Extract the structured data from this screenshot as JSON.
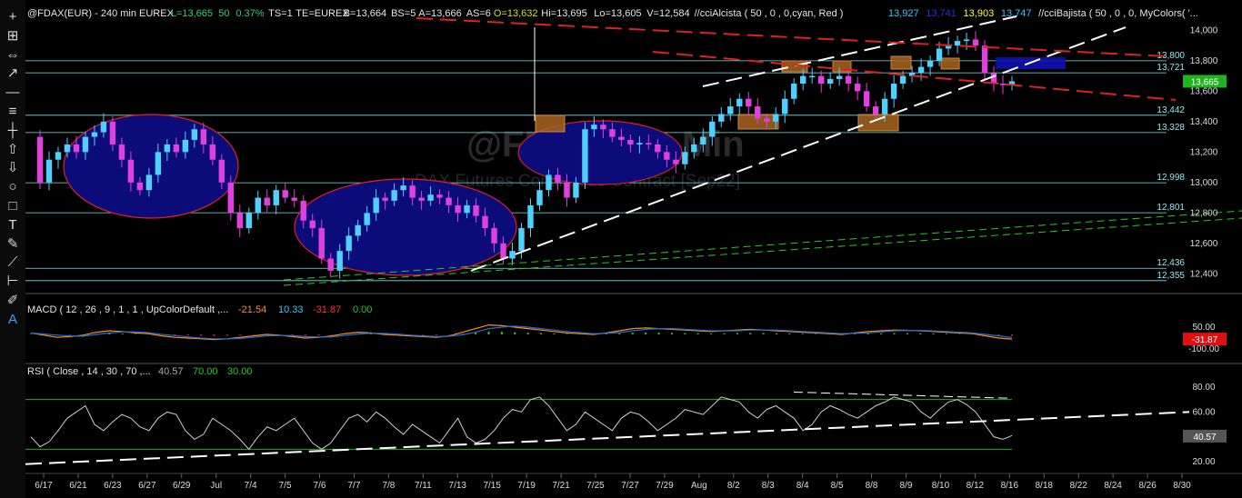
{
  "header": {
    "segments": [
      {
        "text": "@FDAX(EUR) - 240 min  EUREX",
        "color": "#e6e6e6"
      },
      {
        "text": "L=13,665",
        "color": "#27d27d"
      },
      {
        "text": "50",
        "color": "#27d27d"
      },
      {
        "text": "0.37%",
        "color": "#27d27d"
      },
      {
        "text": "TS=1",
        "color": "#e6e6e6"
      },
      {
        "text": "TE=EUREX",
        "color": "#e6e6e6"
      },
      {
        "text": "B=13,664",
        "color": "#e6e6e6"
      },
      {
        "text": "BS=5",
        "color": "#e6e6e6"
      },
      {
        "text": "A=13,666",
        "color": "#e6e6e6"
      },
      {
        "text": "AS=6",
        "color": "#e6e6e6"
      },
      {
        "text": "O=13,632",
        "color": "#c8e61e"
      },
      {
        "text": "Hi=13,695",
        "color": "#e6e6e6"
      },
      {
        "text": "Lo=13,605",
        "color": "#e6e6e6"
      },
      {
        "text": "V=12,584",
        "color": "#e6e6e6"
      },
      {
        "text": "//cciAlcista ( 50 , 0 , 0,cyan, Red )",
        "color": "#e6e6e6"
      },
      {
        "text": "13,927",
        "color": "#32c8ff"
      },
      {
        "text": "13,741",
        "color": "#2830d8"
      },
      {
        "text": "13,903",
        "color": "#ffff32"
      },
      {
        "text": "13,747",
        "color": "#32c8ff"
      },
      {
        "text": "//cciBajista ( 50 , 0 , 0, MyColors( '...",
        "color": "#e6e6e6"
      }
    ]
  },
  "watermark": {
    "symbol": "@FDAX 240 Min",
    "description": "DAX  Futures Continuous Contract [Sep22]"
  },
  "toolbar": {
    "icons": [
      {
        "name": "crosshair-icon",
        "glyph": "+"
      },
      {
        "name": "multi-crosshair-icon",
        "glyph": "⊞"
      },
      {
        "name": "horizontal-measure-icon",
        "glyph": "⇔"
      },
      {
        "name": "trendline-icon",
        "glyph": "↗"
      },
      {
        "name": "horizontal-line-icon",
        "glyph": "—"
      },
      {
        "name": "lines-group-icon",
        "glyph": "≡"
      },
      {
        "name": "vertical-line-icon",
        "glyph": "┼"
      },
      {
        "name": "arrow-up-icon",
        "glyph": "⇧"
      },
      {
        "name": "arrow-down-icon",
        "glyph": "⇩"
      },
      {
        "name": "ellipse-icon",
        "glyph": "○"
      },
      {
        "name": "rectangle-icon",
        "glyph": "□"
      },
      {
        "name": "text-tool-icon",
        "glyph": "T"
      },
      {
        "name": "pencil-icon",
        "glyph": "✎"
      },
      {
        "name": "ruler-icon",
        "glyph": "⟋"
      },
      {
        "name": "fibonacci-icon",
        "glyph": "⊢"
      },
      {
        "name": "paint-icon",
        "glyph": "✐"
      },
      {
        "name": "text-highlight-icon",
        "glyph": "A"
      }
    ]
  },
  "chart_data": {
    "type": "candlestick",
    "colors": {
      "up": "#4fd0ff",
      "down": "#e040e0",
      "channel": "#ffffff",
      "resistance": "#e02020",
      "support": "#28c828",
      "level": "#7fe0e8"
    },
    "price_axis": {
      "min": 12300,
      "max": 14080,
      "ticks": [
        12400,
        12600,
        12800,
        13000,
        13200,
        13400,
        13600,
        13800,
        14000
      ],
      "tick_labels": [
        "12,400",
        "12,600",
        "12,800",
        "13,000",
        "13,200",
        "13,400",
        "13,600",
        "13,800",
        "14,000"
      ],
      "last_price": "13,665"
    },
    "date_axis": {
      "labels": [
        "6/17",
        "6/21",
        "6/23",
        "6/27",
        "6/29",
        "Jul",
        "7/4",
        "7/5",
        "7/6",
        "7/7",
        "7/8",
        "7/11",
        "7/13",
        "7/15",
        "7/19",
        "7/21",
        "7/25",
        "7/27",
        "7/29",
        "Aug",
        "8/2",
        "8/3",
        "8/4",
        "8/5",
        "8/8",
        "8/9",
        "8/10",
        "8/12",
        "8/16",
        "8/18",
        "8/22",
        "8/24",
        "8/26",
        "8/30"
      ]
    },
    "horizontal_levels": [
      {
        "value": 13800,
        "label": "13,800"
      },
      {
        "value": 13721,
        "label": "13,721"
      },
      {
        "value": 13442,
        "label": "13,442"
      },
      {
        "value": 13328,
        "label": "13,328"
      },
      {
        "value": 12998,
        "label": "12,998"
      },
      {
        "value": 12801,
        "label": "12,801"
      },
      {
        "value": 12436,
        "label": "12,436"
      },
      {
        "value": 12355,
        "label": "12,355"
      }
    ],
    "price_series": [
      13300,
      13000,
      13150,
      13200,
      13250,
      13200,
      13300,
      13330,
      13400,
      13250,
      13150,
      13000,
      12950,
      13050,
      13200,
      13250,
      13200,
      13280,
      13350,
      13250,
      13150,
      13000,
      12800,
      12700,
      12800,
      12900,
      12850,
      12950,
      12900,
      12880,
      12750,
      12700,
      12500,
      12420,
      12550,
      12650,
      12720,
      12800,
      12900,
      12880,
      12950,
      12980,
      12900,
      12880,
      12920,
      12900,
      12850,
      12800,
      12850,
      12780,
      12700,
      12600,
      12500,
      12550,
      12700,
      12850,
      12950,
      13050,
      13000,
      12900,
      13000,
      13350,
      13380,
      13350,
      13300,
      13280,
      13250,
      13260,
      13250,
      13200,
      13150,
      13120,
      13200,
      13250,
      13300,
      13400,
      13450,
      13500,
      13550,
      13500,
      13420,
      13400,
      13450,
      13550,
      13650,
      13700,
      13700,
      13650,
      13680,
      13700,
      13650,
      13600,
      13500,
      13450,
      13550,
      13650,
      13700,
      13720,
      13760,
      13800,
      13880,
      13900,
      13930,
      13940,
      13900,
      13720,
      13650,
      13640,
      13665
    ],
    "macd": {
      "label": "MACD ( 12 , 26 , 9 , 1 , 1 , UpColorDefault ,...",
      "values": [
        "-21.54",
        "10.33",
        "-31.87",
        "0.00"
      ],
      "value_colors": [
        "#ff8c1e",
        "#32c8ff",
        "#ff3232",
        "#28c828"
      ],
      "axis_ticks": [
        {
          "value": 50,
          "label": "50.00"
        },
        {
          "value": -100,
          "label": "-100.00"
        }
      ],
      "last": "-31.87",
      "series": [
        10,
        -5,
        -20,
        -15,
        -5,
        15,
        25,
        20,
        10,
        5,
        -10,
        -20,
        -25,
        -30,
        -35,
        -30,
        -20,
        -10,
        0,
        -5,
        -15,
        -25,
        -20,
        -10,
        5,
        15,
        10,
        0,
        -5,
        -10,
        -15,
        -20,
        -10,
        15,
        40,
        65,
        60,
        50,
        40,
        30,
        20,
        10,
        5,
        0,
        10,
        25,
        40,
        45,
        40,
        35,
        30,
        25,
        20,
        25,
        30,
        35,
        30,
        25,
        20,
        15,
        10,
        5,
        0,
        10,
        20,
        25,
        30,
        28,
        25,
        20,
        15,
        10,
        5,
        -10,
        -25,
        -32
      ]
    },
    "rsi": {
      "label": "RSI ( Close , 14 , 30 , 70 ,...",
      "values": [
        "40.57",
        "70.00",
        "30.00"
      ],
      "value_colors": [
        "#aaaaaa",
        "#28c828",
        "#28c828"
      ],
      "axis_ticks": [
        {
          "value": 80,
          "label": "80.00"
        },
        {
          "value": 60,
          "label": "60.00"
        },
        {
          "value": 20,
          "label": "20.00"
        }
      ],
      "last": "40.57",
      "overbought": 70,
      "oversold": 30,
      "series": [
        40,
        32,
        36,
        45,
        55,
        60,
        65,
        50,
        45,
        52,
        58,
        55,
        48,
        45,
        55,
        60,
        58,
        45,
        38,
        42,
        55,
        50,
        45,
        38,
        30,
        40,
        48,
        45,
        50,
        55,
        45,
        35,
        30,
        35,
        45,
        55,
        58,
        52,
        60,
        55,
        48,
        42,
        50,
        45,
        40,
        35,
        45,
        55,
        40,
        35,
        38,
        45,
        55,
        62,
        60,
        70,
        72,
        65,
        55,
        45,
        50,
        60,
        55,
        50,
        45,
        55,
        60,
        58,
        52,
        45,
        50,
        55,
        62,
        60,
        58,
        65,
        72,
        70,
        68,
        60,
        55,
        62,
        65,
        60,
        55,
        45,
        50,
        60,
        65,
        62,
        58,
        55,
        60,
        65,
        68,
        72,
        70,
        68,
        60,
        55,
        62,
        68,
        70,
        66,
        60,
        50,
        40,
        38,
        41
      ]
    }
  }
}
